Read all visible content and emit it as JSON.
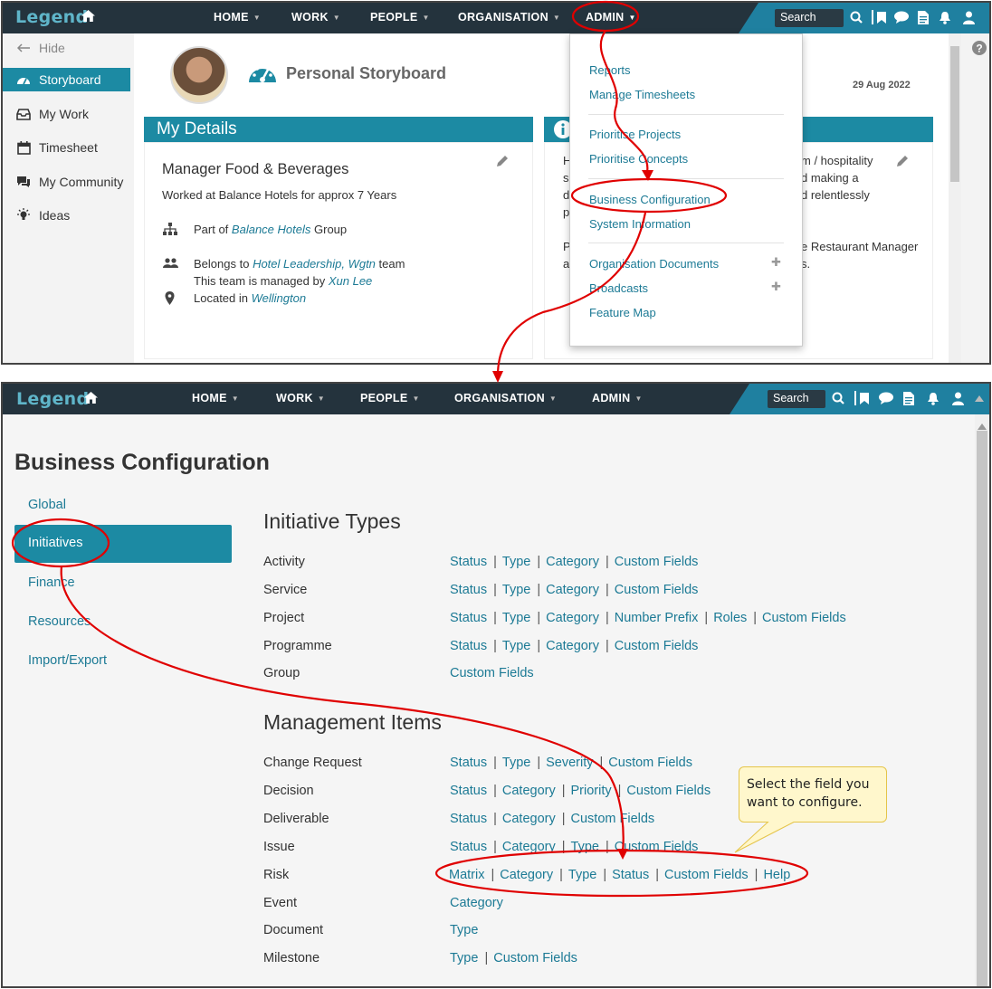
{
  "nav": {
    "logo": "Legend",
    "items": [
      "HOME",
      "WORK",
      "PEOPLE",
      "ORGANISATION",
      "ADMIN"
    ],
    "search_label": "Search"
  },
  "sidebar": {
    "hide_label": "Hide",
    "items": [
      {
        "label": "Storyboard",
        "icon": "dashboard-icon",
        "active": true
      },
      {
        "label": "My Work",
        "icon": "inbox-icon"
      },
      {
        "label": "Timesheet",
        "icon": "calendar-icon"
      },
      {
        "label": "My Community",
        "icon": "chat-icon"
      },
      {
        "label": "Ideas",
        "icon": "lightbulb-icon"
      }
    ]
  },
  "storyboard": {
    "title": "Personal Storyboard",
    "date": "29 Aug 2022",
    "my_details": {
      "heading": "My Details",
      "role": "Manager Food & Beverages",
      "worked_at": "Worked at Balance Hotels for approx 7 Years",
      "group_prefix": "Part of",
      "group_link": "Balance Hotels",
      "group_suffix": "Group",
      "team_prefix": "Belongs to",
      "team_link": "Hotel Leadership, Wgtn",
      "team_suffix": "team",
      "managed_prefix": "This team is managed by",
      "managed_link": "Xun Lee",
      "located_prefix": "Located in",
      "located_link": "Wellington"
    },
    "about": {
      "line1_left": "H",
      "line2_left": "s",
      "line3_left": "d",
      "line4_left": "p",
      "line1_right": "m / hospitality",
      "line2_right": "d making a",
      "line3_right": "d relentlessly",
      "line5_left": "P",
      "line6_left": "a",
      "line5_right": "e Restaurant Manager",
      "line6_right": "s."
    }
  },
  "admin_menu": {
    "items": [
      "Reports",
      "Manage Timesheets",
      "Prioritise Projects",
      "Prioritise Concepts",
      "Business Configuration",
      "System Information",
      "Organisation Documents",
      "Broadcasts",
      "Feature Map"
    ]
  },
  "business_config": {
    "title": "Business Configuration",
    "side_nav": [
      "Global",
      "Initiatives",
      "Finance",
      "Resources",
      "Import/Export"
    ],
    "active_side": "Initiatives",
    "initiative_types_title": "Initiative Types",
    "initiative_types": [
      {
        "label": "Activity",
        "links": [
          "Status",
          "Type",
          "Category",
          "Custom Fields"
        ]
      },
      {
        "label": "Service",
        "links": [
          "Status",
          "Type",
          "Category",
          "Custom Fields"
        ]
      },
      {
        "label": "Project",
        "links": [
          "Status",
          "Type",
          "Category",
          "Number Prefix",
          "Roles",
          "Custom Fields"
        ]
      },
      {
        "label": "Programme",
        "links": [
          "Status",
          "Type",
          "Category",
          "Custom Fields"
        ]
      },
      {
        "label": "Group",
        "links": [
          "Custom Fields"
        ]
      }
    ],
    "management_items_title": "Management Items",
    "management_items": [
      {
        "label": "Change Request",
        "links": [
          "Status",
          "Type",
          "Severity",
          "Custom Fields"
        ]
      },
      {
        "label": "Decision",
        "links": [
          "Status",
          "Category",
          "Priority",
          "Custom Fields"
        ]
      },
      {
        "label": "Deliverable",
        "links": [
          "Status",
          "Category",
          "Custom Fields"
        ]
      },
      {
        "label": "Issue",
        "links": [
          "Status",
          "Category",
          "Type",
          "Custom Fields"
        ]
      },
      {
        "label": "Risk",
        "links": [
          "Matrix",
          "Category",
          "Type",
          "Status",
          "Custom Fields",
          "Help"
        ]
      },
      {
        "label": "Event",
        "links": [
          "Category"
        ]
      },
      {
        "label": "Document",
        "links": [
          "Type"
        ]
      },
      {
        "label": "Milestone",
        "links": [
          "Type",
          "Custom Fields"
        ]
      }
    ]
  },
  "callout": {
    "text": "Select the field you want to configure."
  },
  "colors": {
    "navbar": "#24333d",
    "accent": "#1c8aa3",
    "link": "#1c7a95",
    "annotation": "#e00000"
  }
}
